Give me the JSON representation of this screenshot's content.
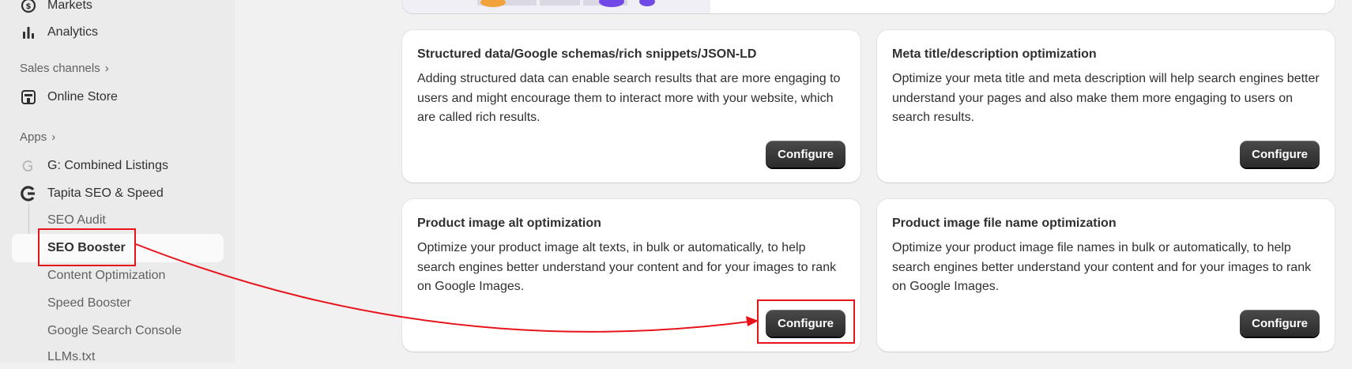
{
  "sidebar": {
    "markets": "Markets",
    "analytics": "Analytics",
    "sales_channels": "Sales channels",
    "online_store": "Online Store",
    "apps": "Apps",
    "combined_listings": "G: Combined Listings",
    "tapita": "Tapita SEO & Speed",
    "sub_items": [
      "SEO Audit",
      "SEO Booster",
      "Content Optimization",
      "Speed Booster",
      "Google Search Console",
      "LLMs.txt"
    ]
  },
  "cards": [
    {
      "title": "Structured data/Google schemas/rich snippets/JSON-LD",
      "description": "Adding structured data can enable search results that are more engaging to users and might encourage them to interact more with your website, which are called rich results.",
      "button": "Configure"
    },
    {
      "title": "Meta title/description optimization",
      "description": "Optimize your meta title and meta description will help search engines better understand your pages and also make them more engaging to users on search results.",
      "button": "Configure"
    },
    {
      "title": "Product image alt optimization",
      "description": "Optimize your product image alt texts, in bulk or automatically, to help search engines better understand your content and for your images to rank on Google Images.",
      "button": "Configure"
    },
    {
      "title": "Product image file name optimization",
      "description": "Optimize your product image file names in bulk or automatically, to help search engines better understand your content and for your images to rank on Google Images.",
      "button": "Configure"
    }
  ],
  "colors": {
    "annotation": "#e8141c",
    "button": "#303030",
    "sidebar_bg": "#ebebeb",
    "page_bg": "#f1f1f1"
  }
}
